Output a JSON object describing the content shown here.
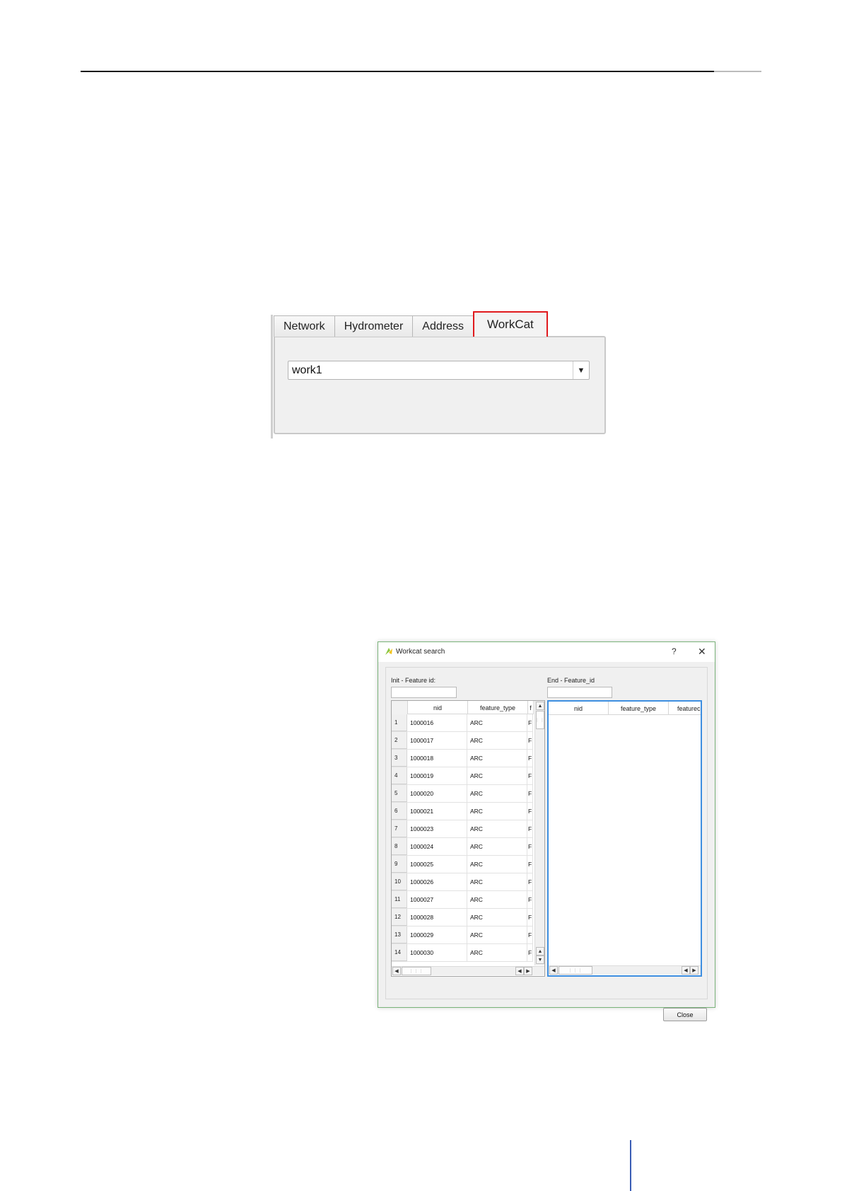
{
  "tabs_widget": {
    "tabs": [
      {
        "label": "Network",
        "active": false
      },
      {
        "label": "Hydrometer",
        "active": false
      },
      {
        "label": "Address",
        "active": false
      },
      {
        "label": "WorkCat",
        "active": true
      }
    ],
    "combo_value": "work1",
    "highlight_color": "#e0191d"
  },
  "dialog": {
    "title": "Workcat search",
    "help_label": "?",
    "close_glyph": "✕",
    "init_label": "Init - Feature id:",
    "end_label": "End - Feature_id",
    "close_button": "Close",
    "left_table": {
      "columns": [
        "nid",
        "feature_type",
        "f"
      ],
      "rows": [
        {
          "num": "1",
          "nid": "1000016",
          "type": "ARC",
          "extra": "F"
        },
        {
          "num": "2",
          "nid": "1000017",
          "type": "ARC",
          "extra": "F"
        },
        {
          "num": "3",
          "nid": "1000018",
          "type": "ARC",
          "extra": "F"
        },
        {
          "num": "4",
          "nid": "1000019",
          "type": "ARC",
          "extra": "F"
        },
        {
          "num": "5",
          "nid": "1000020",
          "type": "ARC",
          "extra": "F"
        },
        {
          "num": "6",
          "nid": "1000021",
          "type": "ARC",
          "extra": "F"
        },
        {
          "num": "7",
          "nid": "1000023",
          "type": "ARC",
          "extra": "F"
        },
        {
          "num": "8",
          "nid": "1000024",
          "type": "ARC",
          "extra": "F"
        },
        {
          "num": "9",
          "nid": "1000025",
          "type": "ARC",
          "extra": "F"
        },
        {
          "num": "10",
          "nid": "1000026",
          "type": "ARC",
          "extra": "F"
        },
        {
          "num": "11",
          "nid": "1000027",
          "type": "ARC",
          "extra": "F"
        },
        {
          "num": "12",
          "nid": "1000028",
          "type": "ARC",
          "extra": "F"
        },
        {
          "num": "13",
          "nid": "1000029",
          "type": "ARC",
          "extra": "F"
        },
        {
          "num": "14",
          "nid": "1000030",
          "type": "ARC",
          "extra": "F"
        }
      ]
    },
    "right_table": {
      "columns": [
        "nid",
        "feature_type",
        "featurec"
      ]
    }
  }
}
